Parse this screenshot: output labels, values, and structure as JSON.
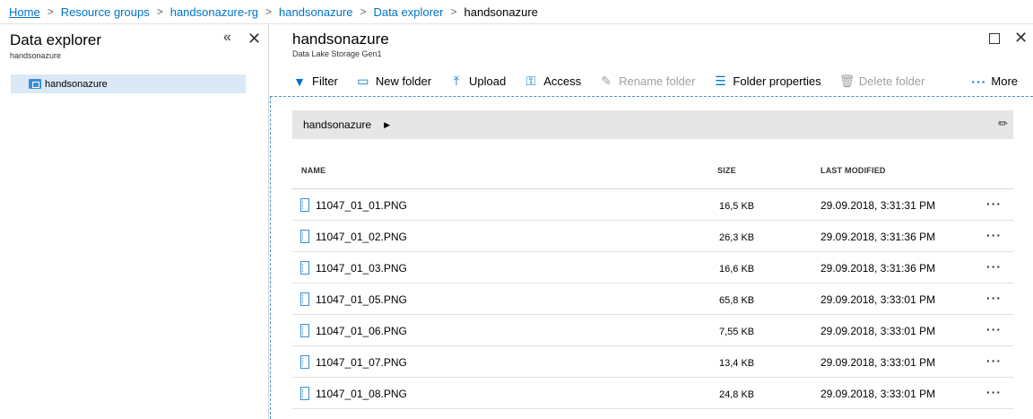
{
  "breadcrumb": {
    "items": [
      "Home",
      "Resource groups",
      "handsonazure-rg",
      "handsonazure",
      "Data explorer",
      "handsonazure"
    ]
  },
  "left_panel": {
    "title": "Data explorer",
    "subtitle": "handsonazure",
    "collapse_icon": "double-chevron-left-icon",
    "close_icon": "close-icon",
    "tree": [
      {
        "label": "handsonazure",
        "icon": "folder-icon",
        "selected": true
      }
    ]
  },
  "right_panel": {
    "title": "handsonazure",
    "subtitle": "Data Lake Storage Gen1",
    "maximize_icon": "maximize-icon",
    "close_icon": "close-icon"
  },
  "toolbar": {
    "filter": "Filter",
    "new_folder": "New folder",
    "upload": "Upload",
    "access": "Access",
    "rename_folder": "Rename folder",
    "folder_properties": "Folder properties",
    "delete_folder": "Delete folder",
    "more": "More"
  },
  "path": {
    "segment": "handsonazure",
    "edit_icon": "pencil-icon"
  },
  "table": {
    "headers": {
      "name": "NAME",
      "size": "SIZE",
      "modified": "LAST MODIFIED"
    },
    "rows": [
      {
        "name": "11047_01_01.PNG",
        "size": "16,5 KB",
        "modified": "29.09.2018, 3:31:31 PM"
      },
      {
        "name": "11047_01_02.PNG",
        "size": "26,3 KB",
        "modified": "29.09.2018, 3:31:36 PM"
      },
      {
        "name": "11047_01_03.PNG",
        "size": "16,6 KB",
        "modified": "29.09.2018, 3:31:36 PM"
      },
      {
        "name": "11047_01_05.PNG",
        "size": "65,8 KB",
        "modified": "29.09.2018, 3:33:01 PM"
      },
      {
        "name": "11047_01_06.PNG",
        "size": "7,55 KB",
        "modified": "29.09.2018, 3:33:01 PM"
      },
      {
        "name": "11047_01_07.PNG",
        "size": "13,4 KB",
        "modified": "29.09.2018, 3:33:01 PM"
      },
      {
        "name": "11047_01_08.PNG",
        "size": "24,8 KB",
        "modified": "29.09.2018, 3:33:01 PM"
      }
    ]
  },
  "colors": {
    "accent": "#0072c6",
    "selected_bg": "#dbe8f5",
    "pathbar_bg": "#e6e6e6",
    "disabled_text": "#a0a0a0"
  }
}
